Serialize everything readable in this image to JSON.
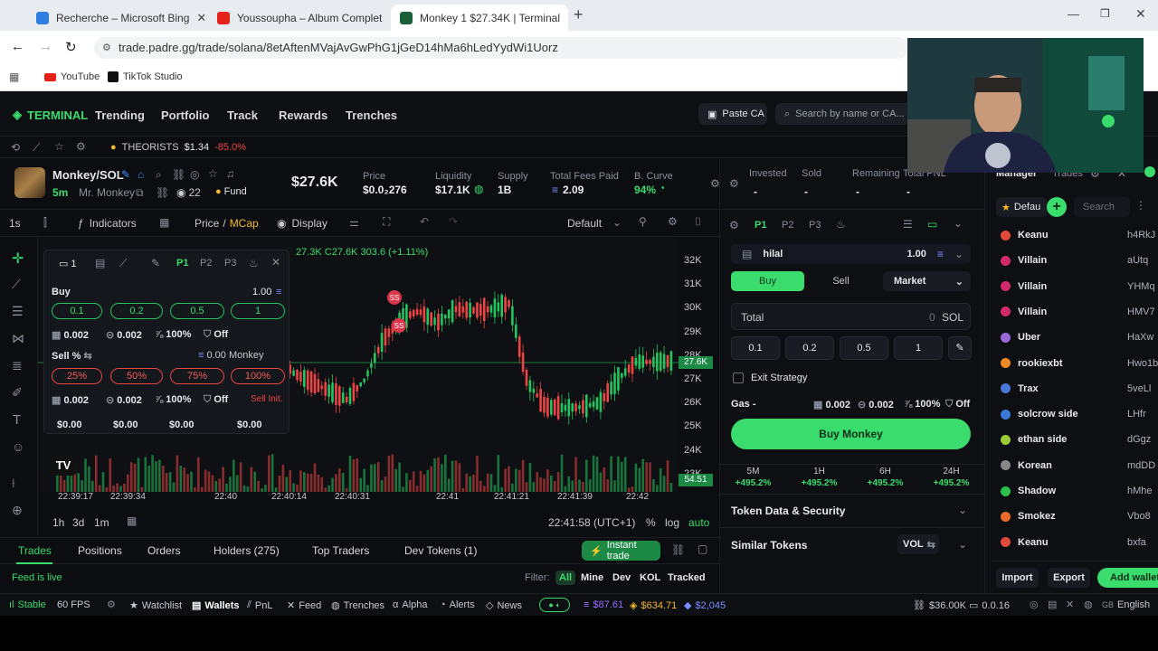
{
  "browser": {
    "tabs": [
      {
        "title": "Recherche – Microsoft Bing",
        "color": "#2f7de1"
      },
      {
        "title": "Youssoupha – Album Complet",
        "color": "#e62117"
      },
      {
        "title": "Monkey 1 $27.34K | Terminal",
        "color": "#1b5e3a"
      }
    ],
    "url": "trade.padre.gg/trade/solana/8etAftenMVajAvGwPhG1jGeD14hMa6hLedYydWi1Uorz",
    "bookmarks": [
      "YouTube",
      "TikTok Studio"
    ]
  },
  "nav": {
    "logo": "TERMINAL",
    "links": [
      "Trending",
      "Portfolio",
      "Track",
      "Rewards",
      "Trenches"
    ],
    "paste": "Paste CA",
    "search_placeholder": "Search by name or CA..."
  },
  "ticker": {
    "name": "THEORISTS",
    "price": "$1.34",
    "change": "-85.0%"
  },
  "token": {
    "pair": "Monkey/SOL",
    "age": "5m",
    "name": "Mr. Monkey",
    "holders": "22",
    "fund": "Fund",
    "mcap": "$27.6K",
    "stats": [
      {
        "label": "Price",
        "value": "$0.0₂276"
      },
      {
        "label": "Liquidity",
        "value": "$17.1K"
      },
      {
        "label": "Supply",
        "value": "1B"
      },
      {
        "label": "Total Fees Paid",
        "value": "2.09"
      },
      {
        "label": "B. Curve",
        "value": "94%"
      }
    ]
  },
  "charttools": {
    "interval": "1s",
    "indicators": "Indicators",
    "price": "Price",
    "mcap": "MCap",
    "display": "Display",
    "layout": "Default"
  },
  "chart": {
    "ohlc": "27.3K C27.6K 303.6 (+1.11%)",
    "yticks": [
      "32K",
      "31K",
      "30K",
      "29K",
      "28K",
      "27K",
      "26K",
      "25K",
      "24K",
      "23K"
    ],
    "price_tag": "27.6K",
    "low_tag": "54.51",
    "xticks": [
      "22:39:17",
      "22:39:34",
      "22:40",
      "22:40:14",
      "22:40:31",
      "22:41",
      "22:41:21",
      "22:41:39",
      "22:42"
    ],
    "ranges": [
      "1h",
      "3d",
      "1m"
    ],
    "time": "22:41:58 (UTC+1)",
    "pct": "%",
    "log": "log",
    "auto": "auto",
    "marker": "SS",
    "candle_color_up": "#22c55e",
    "candle_color_down": "#ef4444"
  },
  "quick": {
    "count": "1",
    "presets": [
      "P1",
      "P2",
      "P3"
    ],
    "buy_label": "Buy",
    "buy_amount": "1.00",
    "buy_chips": [
      "0.1",
      "0.2",
      "0.5",
      "1"
    ],
    "settings": [
      "0.002",
      "0.002",
      "100%",
      "Off"
    ],
    "sell_label": "Sell %",
    "sell_balance": "0.00 Monkey",
    "sell_chips": [
      "25%",
      "50%",
      "75%",
      "100%"
    ],
    "sell_settings": [
      "0.002",
      "0.002",
      "100%",
      "Off"
    ],
    "sell_init": "Sell Init.",
    "totals": [
      "$0.00",
      "$0.00",
      "$0.00",
      "$0.00"
    ]
  },
  "bottom": {
    "tabs": [
      "Trades",
      "Positions",
      "Orders",
      "Holders (275)",
      "Top Traders",
      "Dev Tokens (1)"
    ],
    "instant": "Instant trade",
    "feed": "Feed is live",
    "filter_label": "Filter:",
    "filters": [
      "All",
      "Mine",
      "Dev",
      "KOL",
      "Tracked"
    ]
  },
  "trade": {
    "summary": [
      {
        "label": "Invested",
        "value": "-"
      },
      {
        "label": "Sold",
        "value": "-"
      },
      {
        "label": "Remaining",
        "value": "-"
      },
      {
        "label": "Total PNL",
        "value": "-"
      }
    ],
    "presets": [
      "P1",
      "P2",
      "P3"
    ],
    "wallet": "hilal",
    "wallet_amount": "1.00",
    "buy": "Buy",
    "sell": "Sell",
    "order_type": "Market",
    "total_label": "Total",
    "total_value": "0",
    "total_unit": "SOL",
    "amounts": [
      "0.1",
      "0.2",
      "0.5",
      "1"
    ],
    "exit": "Exit Strategy",
    "gas_label": "Gas -",
    "gas": [
      "0.002",
      "0.002",
      "100%",
      "Off"
    ],
    "cta": "Buy Monkey",
    "changes": [
      {
        "label": "5M",
        "value": "+495.2%"
      },
      {
        "label": "1H",
        "value": "+495.2%"
      },
      {
        "label": "6H",
        "value": "+495.2%"
      },
      {
        "label": "24H",
        "value": "+495.2%"
      }
    ],
    "security": "Token Data & Security",
    "similar": "Similar Tokens",
    "vol": "VOL"
  },
  "manager": {
    "tabs": [
      "Manager",
      "Trades"
    ],
    "default": "Defau",
    "search": "Search",
    "wallets": [
      {
        "name": "Keanu",
        "addr": "h4RkJ",
        "color": "#e04a3a"
      },
      {
        "name": "Villain",
        "addr": "aUtq",
        "color": "#d12a6a"
      },
      {
        "name": "Villain",
        "addr": "YHMq",
        "color": "#d12a6a"
      },
      {
        "name": "Villain",
        "addr": "HMV7",
        "color": "#d12a6a"
      },
      {
        "name": "Uber",
        "addr": "HaXw",
        "color": "#9a6ad8"
      },
      {
        "name": "rookiexbt",
        "addr": "Hwo1b",
        "color": "#f08a24"
      },
      {
        "name": "Trax",
        "addr": "5veLl",
        "color": "#4a78d8"
      },
      {
        "name": "solcrow side",
        "addr": "LHfr",
        "color": "#3a7ad8"
      },
      {
        "name": "ethan side",
        "addr": "dGgz",
        "color": "#9ccc3a"
      },
      {
        "name": "Korean",
        "addr": "mdDD",
        "color": "#888888"
      },
      {
        "name": "Shadow",
        "addr": "hMhe",
        "color": "#2ac24a"
      },
      {
        "name": "Smokez",
        "addr": "Vbo8",
        "color": "#e86a2a"
      },
      {
        "name": "Keanu",
        "addr": "bxfa",
        "color": "#e04a3a"
      }
    ],
    "import": "Import",
    "export": "Export",
    "add": "Add wallet"
  },
  "footer": {
    "status": "Stable",
    "fps": "60 FPS",
    "items": [
      "Watchlist",
      "Wallets",
      "PnL",
      "Feed",
      "Trenches",
      "Alpha",
      "Alerts",
      "News"
    ],
    "prices": [
      {
        "value": "$87.61",
        "color": "#9b6cff"
      },
      {
        "value": "$634.71",
        "color": "#f5b82e"
      },
      {
        "value": "$2,045",
        "color": "#7b8cff"
      }
    ],
    "right": [
      "$36.00K",
      "0.0.16",
      "English"
    ]
  }
}
